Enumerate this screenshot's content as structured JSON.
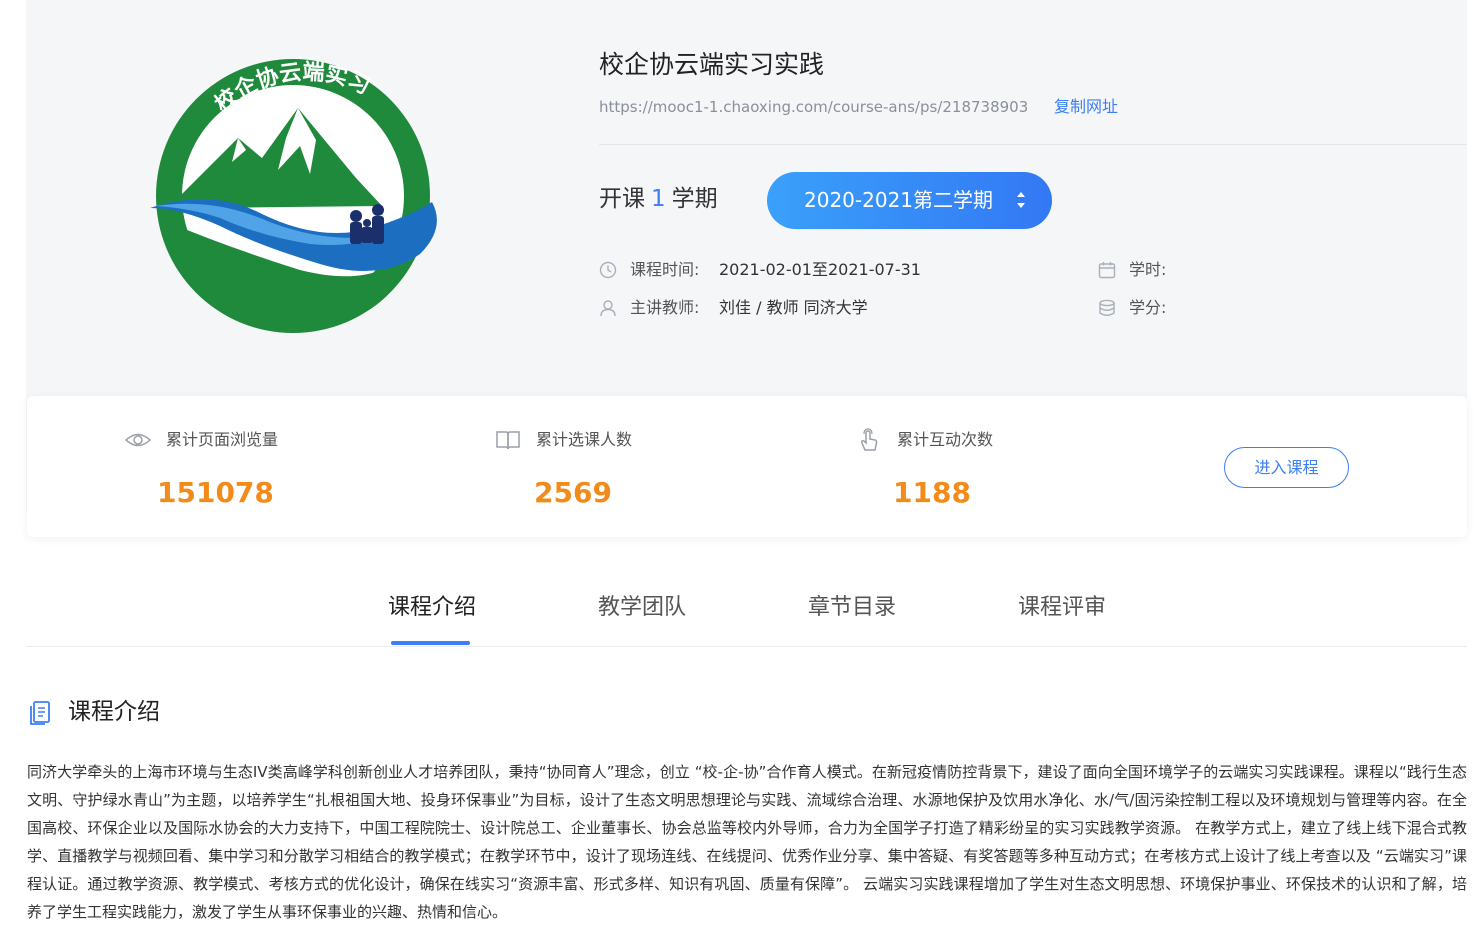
{
  "course": {
    "title": "校企协云端实习实践",
    "url": "https://mooc1-1.chaoxing.com/course-ans/ps/218738903",
    "copy_label": "复制网址",
    "logo_text": "校企协云端实习"
  },
  "term": {
    "prefix": "开课",
    "count": "1",
    "suffix": "学期",
    "selected": "2020-2021第二学期"
  },
  "info": {
    "time_label": "课程时间:",
    "time_value": "2021-02-01至2021-07-31",
    "teacher_label": "主讲教师:",
    "teacher_value": "刘佳 / 教师 同济大学",
    "hours_label": "学时:",
    "credit_label": "学分:"
  },
  "stats": {
    "views_label": "累计页面浏览量",
    "views_value": "151078",
    "enrolled_label": "累计选课人数",
    "enrolled_value": "2569",
    "interactions_label": "累计互动次数",
    "interactions_value": "1188",
    "enter_label": "进入课程"
  },
  "tabs": [
    {
      "label": "课程介绍",
      "active": true
    },
    {
      "label": "教学团队",
      "active": false
    },
    {
      "label": "章节目录",
      "active": false
    },
    {
      "label": "课程评审",
      "active": false
    }
  ],
  "section": {
    "title": "课程介绍",
    "body": "同济大学牵头的上海市环境与生态IV类高峰学科创新创业人才培养团队，秉持“协同育人”理念，创立 “校-企-协”合作育人模式。在新冠疫情防控背景下，建设了面向全国环境学子的云端实习实践课程。课程以“践行生态文明、守护绿水青山”为主题，以培养学生“扎根祖国大地、投身环保事业”为目标，设计了生态文明思想理论与实践、流域综合治理、水源地保护及饮用水净化、水/气/固污染控制工程以及环境规划与管理等内容。在全国高校、环保企业以及国际水协会的大力支持下，中国工程院院士、设计院总工、企业董事长、协会总监等校内外导师，合力为全国学子打造了精彩纷呈的实习实践教学资源。 在教学方式上，建立了线上线下混合式教学、直播教学与视频回看、集中学习和分散学习相结合的教学模式；在教学环节中，设计了现场连线、在线提问、优秀作业分享、集中答疑、有奖答题等多种互动方式；在考核方式上设计了线上考查以及 “云端实习”课程认证。通过教学资源、教学模式、考核方式的优化设计，确保在线实习“资源丰富、形式多样、知识有巩固、质量有保障”。 云端实习实践课程增加了学生对生态文明思想、环境保护事业、环保技术的认识和了解，培养了学生工程实践能力，激发了学生从事环保事业的兴趣、热情和信心。"
  },
  "colors": {
    "accent": "#3d7ef5",
    "stat_number": "#f28b1a",
    "logo_green": "#1f8a3c",
    "logo_blue": "#1c6fc0"
  },
  "icons": {
    "time": "clock-icon",
    "teacher": "user-icon",
    "hours": "calendar-icon",
    "credit": "database-icon",
    "views": "eye-icon",
    "enrolled": "book-icon",
    "interactions": "hand-pointer-icon",
    "section": "document-icon"
  }
}
